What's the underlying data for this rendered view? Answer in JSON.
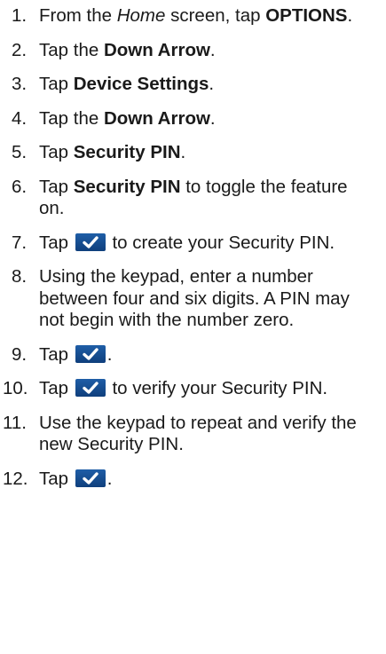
{
  "steps": [
    {
      "num": "1.",
      "parts": [
        {
          "t": "From the "
        },
        {
          "t": "Home",
          "style": "i"
        },
        {
          "t": " screen, tap "
        },
        {
          "t": "OPTIONS",
          "style": "b"
        },
        {
          "t": "."
        }
      ]
    },
    {
      "num": "2.",
      "parts": [
        {
          "t": "Tap the "
        },
        {
          "t": "Down Arrow",
          "style": "b"
        },
        {
          "t": "."
        }
      ]
    },
    {
      "num": "3.",
      "parts": [
        {
          "t": "Tap "
        },
        {
          "t": "Device Settings",
          "style": "b"
        },
        {
          "t": "."
        }
      ]
    },
    {
      "num": "4.",
      "parts": [
        {
          "t": "Tap the "
        },
        {
          "t": "Down Arrow",
          "style": "b"
        },
        {
          "t": "."
        }
      ]
    },
    {
      "num": "5.",
      "parts": [
        {
          "t": "Tap "
        },
        {
          "t": "Security PIN",
          "style": "b"
        },
        {
          "t": "."
        }
      ]
    },
    {
      "num": "6.",
      "parts": [
        {
          "t": "Tap "
        },
        {
          "t": "Security PIN",
          "style": "b"
        },
        {
          "t": " to toggle the feature on."
        }
      ]
    },
    {
      "num": "7.",
      "parts": [
        {
          "t": "Tap "
        },
        {
          "icon": "check-icon"
        },
        {
          "t": " to create your Security PIN."
        }
      ]
    },
    {
      "num": "8.",
      "parts": [
        {
          "t": "Using the keypad, enter a number between four and six digits. A PIN may not begin with the number zero."
        }
      ]
    },
    {
      "num": "9.",
      "parts": [
        {
          "t": "Tap "
        },
        {
          "icon": "check-icon"
        },
        {
          "t": "."
        }
      ]
    },
    {
      "num": "10.",
      "parts": [
        {
          "t": "Tap "
        },
        {
          "icon": "check-icon"
        },
        {
          "t": " to verify your Security PIN."
        }
      ]
    },
    {
      "num": "11.",
      "parts": [
        {
          "t": "Use the keypad to repeat and verify the new Security PIN."
        }
      ]
    },
    {
      "num": "12.",
      "parts": [
        {
          "t": "Tap "
        },
        {
          "icon": "check-icon"
        },
        {
          "t": "."
        }
      ]
    }
  ],
  "colors": {
    "text": "#1a1a1a",
    "check_button": "#1a4f91",
    "check_mark": "#ffffff"
  }
}
